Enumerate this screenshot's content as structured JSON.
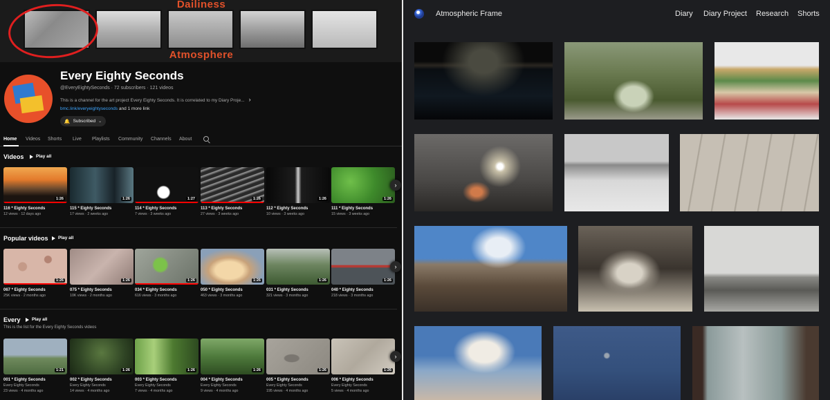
{
  "banner": {
    "top_label": "Dailiness",
    "bottom_label": "Atmosphere"
  },
  "channel": {
    "name": "Every Eighty Seconds",
    "meta": "@EveryEightySeconds · 72 subscribers · 121 videos",
    "description": "This is a channel for the art project Every Eighty Seconds. It is correlated to my Diary Proje...",
    "link_url": "bmc.link/everyeightyseconds",
    "link_more": " and 1 more link",
    "subscribe_label": "Subscribed"
  },
  "tabs": [
    "Home",
    "Videos",
    "Shorts",
    "Live",
    "Playlists",
    "Community",
    "Channels",
    "About"
  ],
  "sections": {
    "videos": {
      "title": "Videos",
      "play_all": "Play all"
    },
    "popular": {
      "title": "Popular videos",
      "play_all": "Play all"
    },
    "every": {
      "title": "Every",
      "play_all": "Play all",
      "subtitle": "This is the list for the Every Eighty Seconds videos"
    }
  },
  "videos": [
    {
      "title": "116 * Eighty Seconds",
      "meta": "12 views · 12 days ago",
      "duration": "1:26"
    },
    {
      "title": "115 * Eighty Seconds",
      "meta": "17 views · 2 weeks ago",
      "duration": "1:26"
    },
    {
      "title": "114 * Eighty Seconds",
      "meta": "7 views · 3 weeks ago",
      "duration": "1:27"
    },
    {
      "title": "113 * Eighty Seconds",
      "meta": "27 views · 3 weeks ago",
      "duration": "1:26"
    },
    {
      "title": "112 * Eighty Seconds",
      "meta": "10 views · 3 weeks ago",
      "duration": "1:26"
    },
    {
      "title": "111 * Eighty Seconds",
      "meta": "15 views · 3 weeks ago",
      "duration": "1:26"
    }
  ],
  "popular": [
    {
      "title": "067 * Eighty Seconds",
      "meta": "25K views · 2 months ago",
      "duration": "1:26"
    },
    {
      "title": "075 * Eighty Seconds",
      "meta": "10K views · 2 months ago",
      "duration": "1:26"
    },
    {
      "title": "034 * Eighty Seconds",
      "meta": "616 views · 3 months ago",
      "duration": "1:26"
    },
    {
      "title": "050 * Eighty Seconds",
      "meta": "463 views · 3 months ago",
      "duration": "1:26"
    },
    {
      "title": "031 * Eighty Seconds",
      "meta": "321 views · 3 months ago",
      "duration": "1:26"
    },
    {
      "title": "040 * Eighty Seconds",
      "meta": "218 views · 3 months ago",
      "duration": "1:26"
    }
  ],
  "every": [
    {
      "title": "001 * Eighty Seconds",
      "channel": "Every Eighty Seconds",
      "meta": "23 views · 4 months ago",
      "duration": "1:21"
    },
    {
      "title": "002 * Eighty Seconds",
      "channel": "Every Eighty Seconds",
      "meta": "14 views · 4 months ago",
      "duration": "1:26"
    },
    {
      "title": "003 * Eighty Seconds",
      "channel": "Every Eighty Seconds",
      "meta": "7 views · 4 months ago",
      "duration": "1:26"
    },
    {
      "title": "004 * Eighty Seconds",
      "channel": "Every Eighty Seconds",
      "meta": "9 views · 4 months ago",
      "duration": "1:26"
    },
    {
      "title": "005 * Eighty Seconds",
      "channel": "Every Eighty Seconds",
      "meta": "195 views · 4 months ago",
      "duration": "1:26"
    },
    {
      "title": "006 * Eighty Seconds",
      "channel": "Every Eighty Seconds",
      "meta": "5 views · 4 months ago",
      "duration": "1:26"
    }
  ],
  "site": {
    "title": "Atmospheric Frame",
    "nav": [
      "Diary",
      "Diary Project",
      "Research",
      "Shorts"
    ]
  },
  "colors": {
    "banner_text": "#e2512a",
    "youtube_red": "#ff0000",
    "link_blue": "#3ea6ff",
    "site_bg": "#1d1e21"
  },
  "icons": [
    "bell-icon",
    "chevron-down-icon",
    "search-icon",
    "play-icon",
    "chevron-right-icon",
    "site-logo-icon"
  ]
}
